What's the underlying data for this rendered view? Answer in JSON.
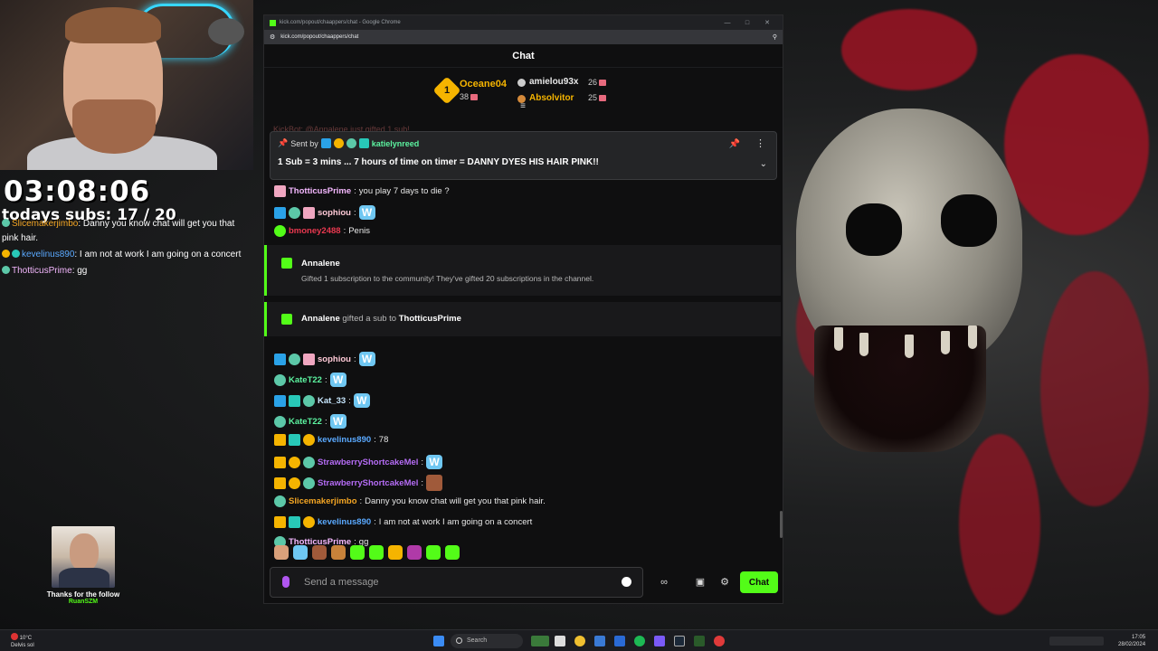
{
  "overlay": {
    "timer": "03:08:06",
    "subs_label": "todays subs:",
    "subs_value": "17 / 20",
    "chat": [
      {
        "user": "Slicemakerjimbo",
        "color": "#f5a623",
        "text": ": Danny you know chat will get you that pink hair."
      },
      {
        "user": "kevelinus890",
        "color": "#5aa9ff",
        "text": ": I am not at work I am going on a concert"
      },
      {
        "user": "ThotticusPrime",
        "color": "#f5b8ff",
        "text": ": gg"
      }
    ],
    "follow_text": "Thanks for the follow",
    "follow_user": "RuanSZM"
  },
  "browser": {
    "title": "kick.com/popout/chaappers/chat - Google Chrome",
    "url": "kick.com/popout/chaappers/chat"
  },
  "chat": {
    "header": "Chat",
    "leaderboard": [
      {
        "rank": "1",
        "name": "Oceane04",
        "count": "38"
      },
      {
        "name": "amielou93x",
        "count": "26"
      },
      {
        "name": "Absolvitor",
        "count": "25"
      }
    ],
    "faded_top": "KickBot: @Annalene just gifted 1 sub!",
    "pinned": {
      "sent_by": "Sent by",
      "user": "katielynreed",
      "message": "1 Sub = 3 mins ... 7 hours of time on timer = DANNY DYES HIS HAIR PINK!!"
    },
    "messages": [
      {
        "user": "ThotticusPrime",
        "color": "#f5b8ff",
        "text": "you play 7 days to die ?"
      },
      {
        "user": "sophiou",
        "color": "#ffc9d6",
        "text": ""
      },
      {
        "user": "bmoney2488",
        "color": "#e8384f",
        "text": "Penis"
      },
      {
        "user": "sophiou",
        "color": "#ffc9d6",
        "text": ""
      },
      {
        "user": "KateT22",
        "color": "#5cf3a0",
        "text": ""
      },
      {
        "user": "Kat_33",
        "color": "#c9e8ff",
        "text": ""
      },
      {
        "user": "KateT22",
        "color": "#5cf3a0",
        "text": ""
      },
      {
        "user": "kevelinus890",
        "color": "#5aa9ff",
        "text": "78"
      },
      {
        "user": "StrawberryShortcakeMel",
        "color": "#b56cf5",
        "text": ""
      },
      {
        "user": "StrawberryShortcakeMel",
        "color": "#b56cf5",
        "text": ""
      },
      {
        "user": "Slicemakerjimbo",
        "color": "#f5a623",
        "text": "Danny you know chat will get you that pink hair."
      },
      {
        "user": "kevelinus890",
        "color": "#5aa9ff",
        "text": "I am not at work I am going on a concert"
      },
      {
        "user": "ThotticusPrime",
        "color": "#f5b8ff",
        "text": "gg"
      }
    ],
    "event1": {
      "title": "Annalene",
      "desc": "Gifted 1 subscription to the community! They've gifted 20 subscriptions in the channel."
    },
    "event2": {
      "gifter": "Annalene",
      "middle": "gifted a sub to",
      "recipient": "ThotticusPrime"
    },
    "input_placeholder": "Send a message",
    "chat_button": "Chat"
  },
  "taskbar": {
    "weather_temp": "10°C",
    "weather_desc": "Delvis sol",
    "search": "Search",
    "time": "17:05",
    "date": "28/02/2024"
  }
}
